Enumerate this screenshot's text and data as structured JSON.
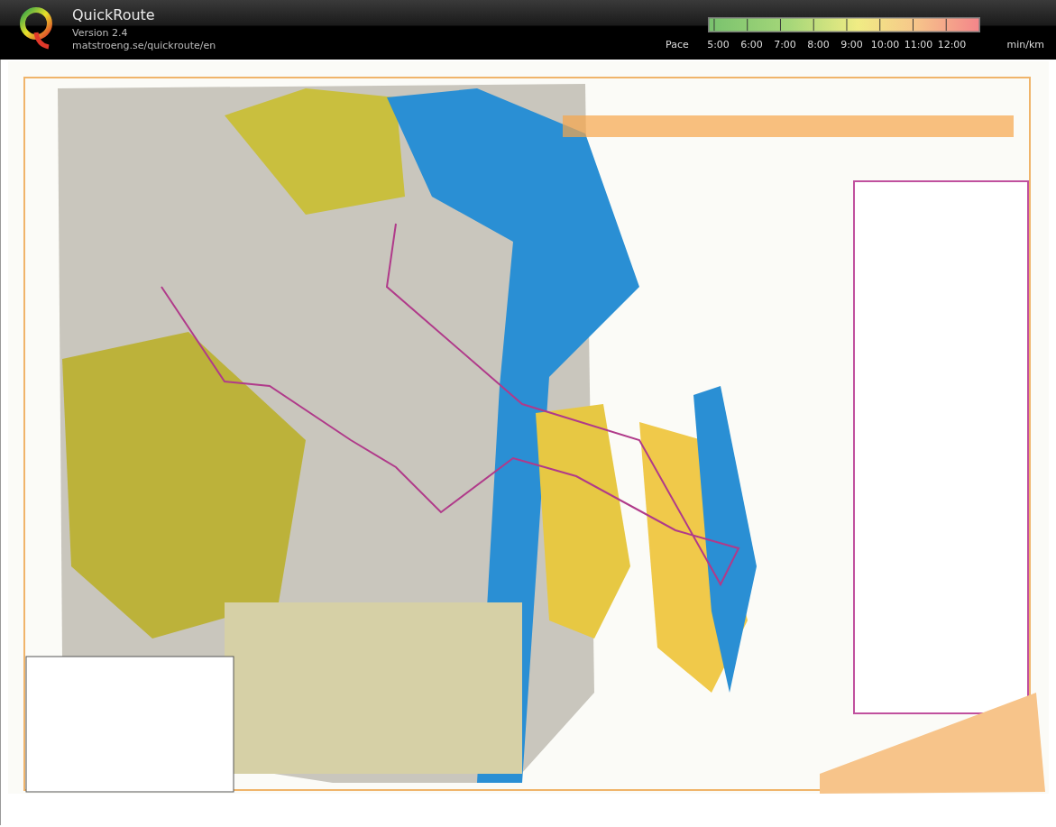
{
  "app": {
    "title": "QuickRoute",
    "version": "Version 2.4",
    "url": "matstroeng.se/quickroute/en"
  },
  "pace_legend": {
    "label": "Pace",
    "ticks": [
      "5:00",
      "6:00",
      "7:00",
      "8:00",
      "9:00",
      "10:00",
      "11:00",
      "12:00"
    ],
    "unit": "min/km"
  }
}
